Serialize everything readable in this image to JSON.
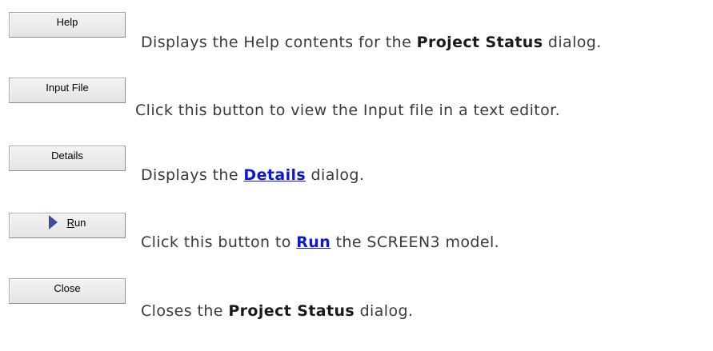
{
  "rows": [
    {
      "button_label": "Help",
      "desc_before": "Displays the Help contents for the ",
      "desc_bold": "Project Status",
      "desc_after": " dialog."
    },
    {
      "button_label": "Input File",
      "desc_text": "Click this button to view the Input file in a text editor."
    },
    {
      "button_label": "Details",
      "desc_before": "Displays the ",
      "desc_link": "Details",
      "desc_after": " dialog."
    },
    {
      "button_label_mnemonic": "R",
      "button_label_rest": "un",
      "button_icon": "play-arrow-icon",
      "desc_before": "Click this button to ",
      "desc_link": "Run",
      "desc_after": " the SCREEN3 model."
    },
    {
      "button_label": "Close",
      "desc_before": "Closes the ",
      "desc_bold": "Project Status",
      "desc_after": " dialog."
    }
  ],
  "colors": {
    "link": "#0b18d8",
    "icon": "#3b4d9b"
  }
}
